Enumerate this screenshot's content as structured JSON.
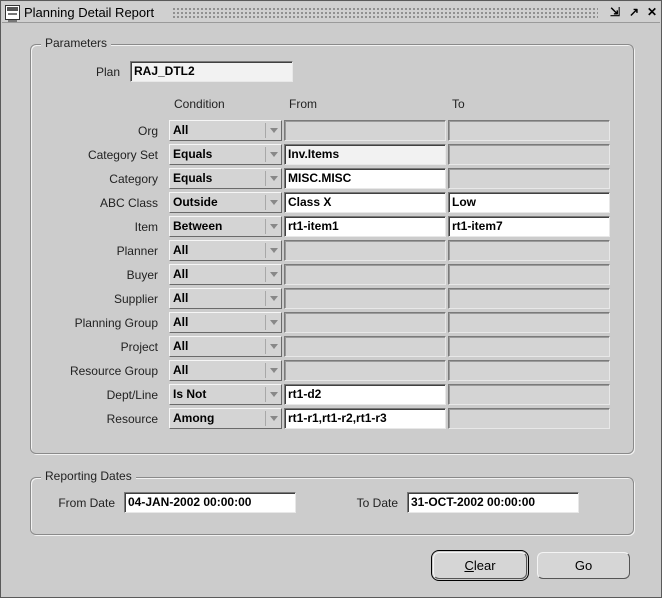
{
  "window": {
    "title": "Planning Detail Report",
    "controls": [
      "⇲",
      "↗",
      "✕"
    ]
  },
  "parameters": {
    "legend": "Parameters",
    "plan_label": "Plan",
    "plan_value": "RAJ_DTL2",
    "column_headers": {
      "condition": "Condition",
      "from": "From",
      "to": "To"
    },
    "rows": [
      {
        "label": "Org",
        "condition": "All",
        "from": "",
        "to": "",
        "from_state": "disabled",
        "to_state": "disabled"
      },
      {
        "label": "Category Set",
        "condition": "Equals",
        "from": "Inv.Items",
        "to": "",
        "from_state": "readonly",
        "to_state": "disabled"
      },
      {
        "label": "Category",
        "condition": "Equals",
        "from": "MISC.MISC",
        "to": "",
        "from_state": "enabled",
        "to_state": "disabled"
      },
      {
        "label": "ABC Class",
        "condition": "Outside",
        "from": "Class X",
        "to": "Low",
        "from_state": "enabled",
        "to_state": "enabled"
      },
      {
        "label": "Item",
        "condition": "Between",
        "from": "rt1-item1",
        "to": "rt1-item7",
        "from_state": "enabled",
        "to_state": "enabled"
      },
      {
        "label": "Planner",
        "condition": "All",
        "from": "",
        "to": "",
        "from_state": "disabled",
        "to_state": "disabled"
      },
      {
        "label": "Buyer",
        "condition": "All",
        "from": "",
        "to": "",
        "from_state": "disabled",
        "to_state": "disabled"
      },
      {
        "label": "Supplier",
        "condition": "All",
        "from": "",
        "to": "",
        "from_state": "disabled",
        "to_state": "disabled"
      },
      {
        "label": "Planning Group",
        "condition": "All",
        "from": "",
        "to": "",
        "from_state": "disabled",
        "to_state": "disabled"
      },
      {
        "label": "Project",
        "condition": "All",
        "from": "",
        "to": "",
        "from_state": "disabled",
        "to_state": "disabled"
      },
      {
        "label": "Resource Group",
        "condition": "All",
        "from": "",
        "to": "",
        "from_state": "disabled",
        "to_state": "disabled"
      },
      {
        "label": "Dept/Line",
        "condition": "Is Not",
        "from": "rt1-d2",
        "to": "",
        "from_state": "enabled",
        "to_state": "disabled"
      },
      {
        "label": "Resource",
        "condition": "Among",
        "from": "rt1-r1,rt1-r2,rt1-r3",
        "to": "",
        "from_state": "enabled",
        "to_state": "disabled"
      }
    ]
  },
  "reporting_dates": {
    "legend": "Reporting Dates",
    "from_label": "From Date",
    "from_value": "04-JAN-2002 00:00:00",
    "to_label": "To Date",
    "to_value": "31-OCT-2002 00:00:00"
  },
  "buttons": {
    "clear_prefix": "",
    "clear_mnemonic": "C",
    "clear_rest": "lear",
    "go": "Go"
  }
}
